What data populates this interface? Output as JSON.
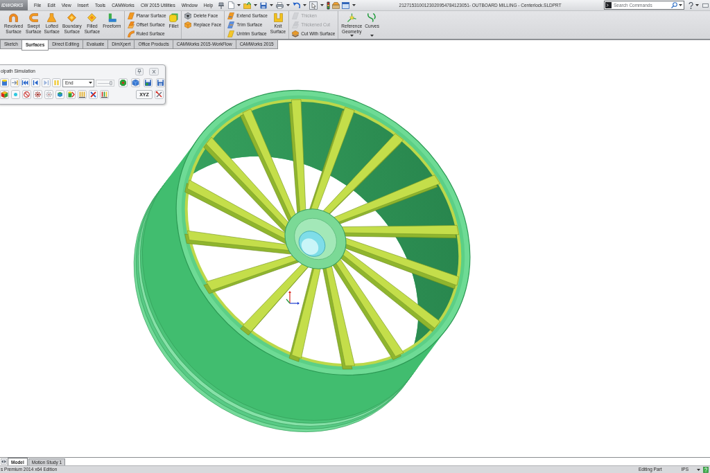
{
  "app_bar": {
    "logo": "IDWORKS",
    "menu": [
      "File",
      "Edit",
      "View",
      "Insert",
      "Tools",
      "CAMWorks",
      "CW 2015 Utilities",
      "Window",
      "Help"
    ],
    "title": "2127153100123020954784123051- OUTBOARD MILLING - Centerlock.SLDPRT",
    "search": {
      "placeholder": "Search Commands"
    }
  },
  "ribbon": {
    "groups": [
      {
        "blocks": [
          {
            "kind": "large",
            "label": "Revolved Surface",
            "disabled": false,
            "menu": false
          },
          {
            "kind": "large",
            "label": "Swept Surface",
            "disabled": false,
            "menu": false
          },
          {
            "kind": "large",
            "label": "Lofted Surface",
            "disabled": false,
            "menu": false
          },
          {
            "kind": "large",
            "label": "Boundary Surface",
            "disabled": false,
            "menu": false
          },
          {
            "kind": "large",
            "label": "Filled Surface",
            "disabled": false,
            "menu": false
          },
          {
            "kind": "large",
            "label": "Freeform",
            "disabled": false,
            "menu": false
          }
        ]
      },
      {
        "blocks": [
          {
            "kind": "stack",
            "items": [
              {
                "label": "Planar Surface",
                "disabled": false
              },
              {
                "label": "Offset Surface",
                "disabled": false
              },
              {
                "label": "Ruled Surface",
                "disabled": false
              }
            ]
          },
          {
            "kind": "large",
            "label": "Fillet",
            "disabled": false,
            "menu": false
          }
        ]
      },
      {
        "blocks": [
          {
            "kind": "stack",
            "items": [
              {
                "label": "Delete Face",
                "disabled": false
              },
              {
                "label": "Replace Face",
                "disabled": false
              }
            ]
          }
        ]
      },
      {
        "blocks": [
          {
            "kind": "stack",
            "items": [
              {
                "label": "Extend Surface",
                "disabled": false
              },
              {
                "label": "Trim Surface",
                "disabled": false
              },
              {
                "label": "Untrim Surface",
                "disabled": false
              }
            ]
          },
          {
            "kind": "large",
            "label": "Knit Surface",
            "disabled": false,
            "menu": false
          }
        ]
      },
      {
        "blocks": [
          {
            "kind": "stack",
            "items": [
              {
                "label": "Thicken",
                "disabled": true
              },
              {
                "label": "Thickened Cut",
                "disabled": true
              },
              {
                "label": "Cut With Surface",
                "disabled": false
              }
            ]
          }
        ]
      },
      {
        "blocks": [
          {
            "kind": "large",
            "label": "Reference Geometry",
            "disabled": false,
            "menu": true
          },
          {
            "kind": "large",
            "label": "Curves",
            "disabled": false,
            "menu": true
          }
        ]
      }
    ]
  },
  "tabs": [
    {
      "label": "Sketch",
      "selected": false
    },
    {
      "label": "Surfaces",
      "selected": true
    },
    {
      "label": "Direct Editing",
      "selected": false
    },
    {
      "label": "Evaluate",
      "selected": false
    },
    {
      "label": "DimXpert",
      "selected": false
    },
    {
      "label": "Office Products",
      "selected": false
    },
    {
      "label": "CAMWorks 2015-WorkFlow",
      "selected": false
    },
    {
      "label": "CAMWorks 2015",
      "selected": false
    }
  ],
  "simulation_panel": {
    "title": "olpath Simulation",
    "stop_mode": {
      "value": "End"
    },
    "speed": {
      "level": 0.9
    },
    "xyz_button": "XYZ"
  },
  "bottom_tabs": [
    {
      "label": "Model",
      "selected": true
    },
    {
      "label": "Motion Study 1",
      "selected": false
    }
  ],
  "status_bar": {
    "edition": "s Premium 2014 x64 Edition",
    "mode": "Editing Part",
    "units": "IPS"
  }
}
